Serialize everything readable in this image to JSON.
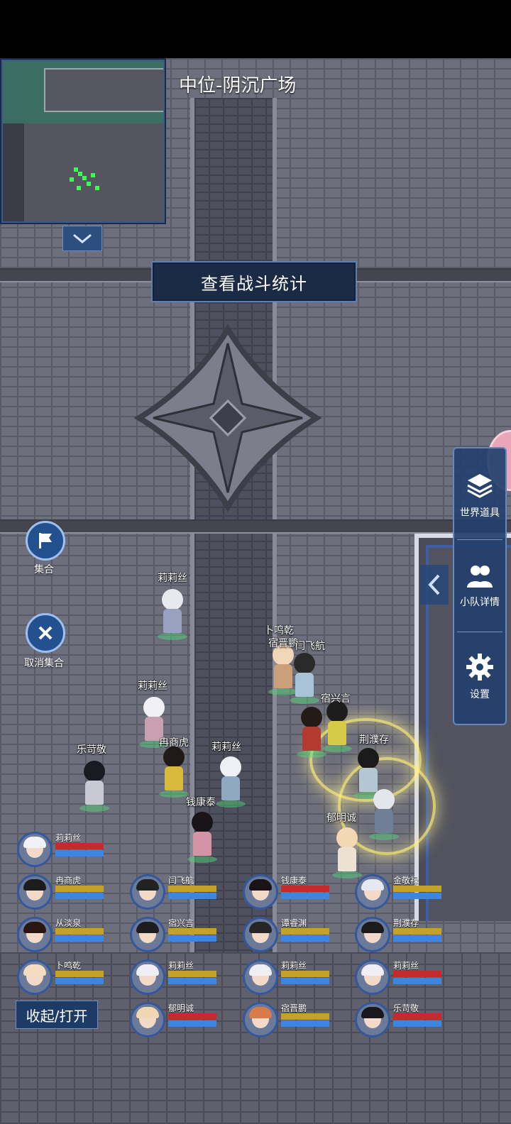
{
  "map": {
    "title": "中位-阴沉广场"
  },
  "battle_stats_label": "查看战斗统计",
  "side_menu": [
    {
      "label": "世界道具",
      "icon": "layers-icon"
    },
    {
      "label": "小队详情",
      "icon": "users-icon"
    },
    {
      "label": "设置",
      "icon": "gear-icon"
    }
  ],
  "rally": {
    "label": "集合",
    "icon": "flag-icon"
  },
  "cancel_rally": {
    "label": "取消集合",
    "icon": "close-icon"
  },
  "characters": [
    {
      "name": "莉莉丝"
    },
    {
      "name": "卜鸣乾"
    },
    {
      "name": "宿晋鹏"
    },
    {
      "name": "闫飞航"
    },
    {
      "name": "莉莉丝"
    },
    {
      "name": "宿兴言"
    },
    {
      "name": "莉莉丝"
    },
    {
      "name": "冉商虎"
    },
    {
      "name": "乐苛敬"
    },
    {
      "name": "莉莉丝"
    },
    {
      "name": "荆濮存"
    },
    {
      "name": "钱康泰"
    },
    {
      "name": "郁明诚"
    }
  ],
  "team": [
    {
      "name": "莉莉丝",
      "hp": 1.0,
      "hp_color": "#c72a2a"
    },
    {
      "name": "冉商虎",
      "hp": 1.0,
      "hp_color": "#c4a22a"
    },
    {
      "name": "闫飞航",
      "hp": 1.0,
      "hp_color": "#c4a22a"
    },
    {
      "name": "钱康泰",
      "hp": 1.0,
      "hp_color": "#c72a2a"
    },
    {
      "name": "金敬禄",
      "hp": 1.0,
      "hp_color": "#c4a22a"
    },
    {
      "name": "从淡泉",
      "hp": 1.0,
      "hp_color": "#c4a22a"
    },
    {
      "name": "宿兴言",
      "hp": 1.0,
      "hp_color": "#c4a22a"
    },
    {
      "name": "谭睿渊",
      "hp": 1.0,
      "hp_color": "#c4a22a"
    },
    {
      "name": "荆濮存",
      "hp": 1.0,
      "hp_color": "#c4a22a"
    },
    {
      "name": "卜鸣乾",
      "hp": 1.0,
      "hp_color": "#c4a22a"
    },
    {
      "name": "莉莉丝",
      "hp": 1.0,
      "hp_color": "#c4a22a"
    },
    {
      "name": "莉莉丝",
      "hp": 1.0,
      "hp_color": "#c4a22a"
    },
    {
      "name": "莉莉丝",
      "hp": 1.0,
      "hp_color": "#c72a2a"
    },
    {
      "name": "郁明诚",
      "hp": 1.0,
      "hp_color": "#c72a2a"
    },
    {
      "name": "宿晋鹏",
      "hp": 1.0,
      "hp_color": "#c4a22a"
    },
    {
      "name": "乐苛敬",
      "hp": 1.0,
      "hp_color": "#c72a2a"
    }
  ],
  "toggle_label": "收起/打开"
}
